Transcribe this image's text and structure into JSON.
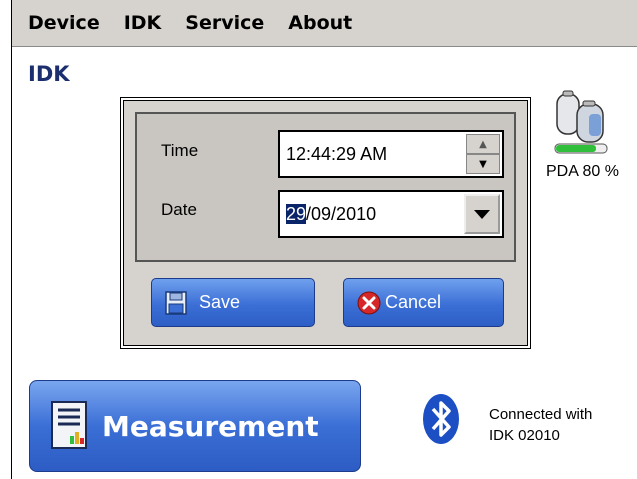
{
  "menu": {
    "items": [
      "Device",
      "IDK",
      "Service",
      "About"
    ]
  },
  "page": {
    "title": "IDK"
  },
  "dialog": {
    "time_label": "Time",
    "time_value": "12:44:29 AM",
    "date_label": "Date",
    "date_day": "29",
    "date_rest": "/09/2010",
    "save_label": "Save",
    "cancel_label": "Cancel"
  },
  "battery": {
    "label": "PDA 80 %",
    "level_percent": 80
  },
  "measurement": {
    "label": "Measurement"
  },
  "connection": {
    "line1": "Connected with",
    "line2": "IDK 02010"
  },
  "colors": {
    "menu_bg": "#d6d3ce",
    "accent_blue": "#3b6fd6",
    "title_blue": "#1b2f6e",
    "selection": "#0a246a"
  }
}
